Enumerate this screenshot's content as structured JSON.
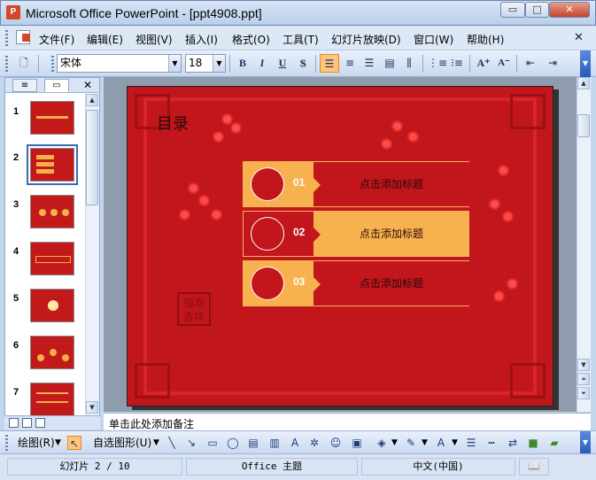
{
  "window": {
    "title": "Microsoft Office PowerPoint - [ppt4908.ppt]",
    "minimize_glyph": "▭",
    "maximize_glyph": "□",
    "close_glyph": "✕"
  },
  "menubar": {
    "items": [
      "文件(F)",
      "编辑(E)",
      "视图(V)",
      "插入(I)",
      "格式(O)",
      "工具(T)",
      "幻灯片放映(D)",
      "窗口(W)",
      "帮助(H)"
    ],
    "close_glyph": "✕"
  },
  "toolbar": {
    "font_name": "宋体",
    "font_size": "18",
    "bold": "B",
    "italic": "I",
    "underline": "U",
    "shadow": "S",
    "grow_font": "A⁺",
    "shrink_font": "A⁻"
  },
  "left_panel": {
    "slide_numbers": [
      "1",
      "2",
      "3",
      "4",
      "5",
      "6",
      "7"
    ],
    "close_glyph": "✕"
  },
  "slide": {
    "title": "目录",
    "seal_text": "福寿吉祥",
    "rows": [
      {
        "num": "01",
        "label": "点击添加标题"
      },
      {
        "num": "02",
        "label": "点击添加标题"
      },
      {
        "num": "03",
        "label": "点击添加标题"
      }
    ]
  },
  "notes": {
    "placeholder": "单击此处添加备注"
  },
  "drawing_toolbar": {
    "draw_label": "绘图(R)",
    "autoshapes_label": "自选图形(U)"
  },
  "statusbar": {
    "slide_position": "幻灯片 2 / 10",
    "theme": "Office 主题",
    "language": "中文(中国)"
  }
}
